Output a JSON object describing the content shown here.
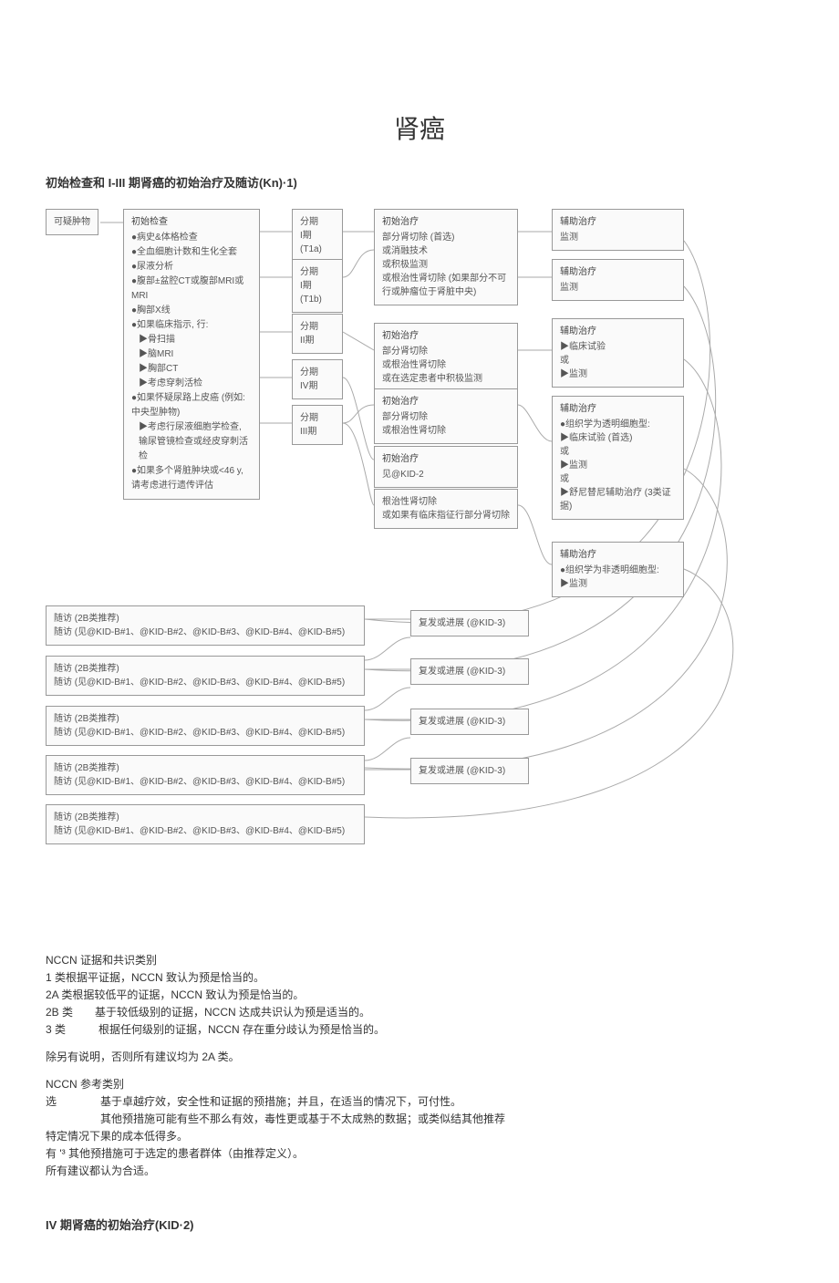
{
  "title": "肾癌",
  "section1_heading": "初始检查和 I-III 期肾癌的初始治疗及随访(Kn)·1)",
  "section2_heading": "IV 期肾癌的初始治疗(KID·2)",
  "box_suspect": "可疑肿物",
  "workup": {
    "title": "初始检查",
    "items": [
      "●病史&体格检查",
      "●全血细胞计数和生化全套",
      "●尿液分析",
      "●腹部±盆腔CT或腹部MRI或MRI",
      "●胸部X线",
      "●如果临床指示, 行:",
      "▶骨扫描",
      "▶脑MRI",
      "▶胸部CT",
      "▶考虑穿刺活检",
      "●如果怀疑尿路上皮癌 (例如: 中央型肿物)",
      "▶考虑行尿液细胞学检查, 输尿管镜检查或经皮穿刺活检",
      "●如果多个肾脏肿块或<46 y, 请考虑进行遗传评估"
    ]
  },
  "stage_t1a": {
    "t": "分期",
    "s": "I期 (T1a)"
  },
  "stage_t1b": {
    "t": "分期",
    "s": "I期 (T1b)"
  },
  "stage_2": {
    "t": "分期",
    "s": "II期"
  },
  "stage_4": {
    "t": "分期",
    "s": "IV期"
  },
  "stage_3": {
    "t": "分期",
    "s": "III期"
  },
  "tx1": {
    "t": "初始治疗",
    "lines": [
      "部分肾切除 (首选)",
      "或消融技术",
      "或积极监测",
      "或根治性肾切除 (如果部分不可行或肿瘤位于肾脏中央)"
    ]
  },
  "tx2": {
    "t": "初始治疗",
    "lines": [
      "部分肾切除",
      "或根治性肾切除",
      "或在选定患者中积极监测"
    ]
  },
  "tx3": {
    "t": "初始治疗",
    "lines": [
      "部分肾切除",
      "或根治性肾切除"
    ]
  },
  "tx4": {
    "t": "初始治疗",
    "lines": [
      "见@KID-2"
    ]
  },
  "tx5": {
    "lines": [
      "根治性肾切除",
      "或如果有临床指征行部分肾切除"
    ]
  },
  "adj1": {
    "t": "辅助治疗",
    "l": "监测"
  },
  "adj2": {
    "t": "辅助治疗",
    "l": "监测"
  },
  "adj3": {
    "t": "辅助治疗",
    "lines": [
      "▶临床试验",
      "或",
      "▶监测"
    ]
  },
  "adj4": {
    "t": "辅助治疗",
    "lines": [
      "●组织学为透明细胞型:",
      "▶临床试验 (首选)",
      "或",
      "▶监测",
      "或",
      "▶舒尼替尼辅助治疗 (3类证据)"
    ]
  },
  "adj5": {
    "t": "辅助治疗",
    "lines": [
      "●组织学为非透明细胞型:",
      "▶监测"
    ]
  },
  "fu": {
    "t": "随访 (2B类推荐)",
    "l": "随访 (见@KID-B#1、@KID-B#2、@KID-B#3、@KID-B#4、@KID-B#5)"
  },
  "relapse": "复发或进展 (@KID-3)",
  "evidence": {
    "h": "NCCN 证据和共识类别",
    "c1": "1 类根据平证据，NCCN 致认为预是恰当的。",
    "c2a": "2A 类根据较低平的证据，NCCN 致认为预是恰当的。",
    "c2b": "2B 类  基于较低级别的证据，NCCN 达成共识认为预是适当的。",
    "c3": "3 类   根据任何级别的证据，NCCN 存在重分歧认为预是恰当的。",
    "note": "除另有说明，否则所有建议均为 2A 类。"
  },
  "pref": {
    "h": "NCCN 参考类别",
    "p1": "选    基于卓越疗效，安全性和证据的预措施；并且，在适当的情况下，可付性。",
    "p2": "     其他预措施可能有些不那么有效，毒性更或基于不太成熟的数据；或类似结其他推荐",
    "p3": "特定情况下果的成本低得多。",
    "p4": "有 '³ 其他预措施可于选定的患者群体（由推荐定义）。",
    "p5": "所有建议都认为合适。"
  }
}
